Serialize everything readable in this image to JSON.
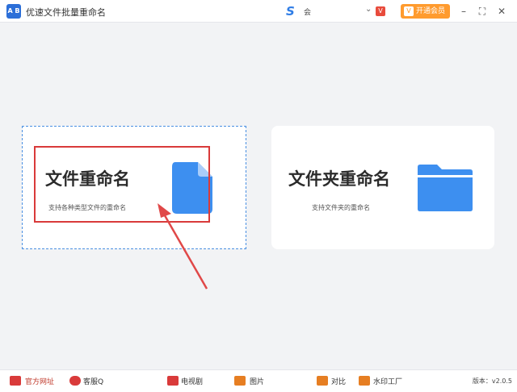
{
  "titlebar": {
    "app_icon_label": "A B",
    "title": "优速文件批量重命名",
    "user_logo": "S",
    "user_name": "会",
    "vip_badge": "V",
    "vip_button_label": "开通会员",
    "vip_button_icon": "V",
    "minimize": "–",
    "maximize": "⛶",
    "close": "✕"
  },
  "cards": {
    "file": {
      "title": "文件重命名",
      "subtitle": "支持各种类型文件的重命名",
      "icon": "file-icon",
      "icon_color": "#3d8ff0"
    },
    "folder": {
      "title": "文件夹重命名",
      "subtitle": "支持文件夹的重命名",
      "icon": "folder-icon",
      "icon_color": "#3d8ff0"
    }
  },
  "bottombar": {
    "website_label": "官方网址",
    "support_label": "客服Q",
    "items": [
      "电视剧",
      "图片",
      "对比",
      "水印工厂"
    ],
    "version": "版本：v2.0.5"
  },
  "colors": {
    "accent": "#3d8ff0",
    "vip": "#ff9b2e",
    "highlight": "#d93a3a"
  }
}
